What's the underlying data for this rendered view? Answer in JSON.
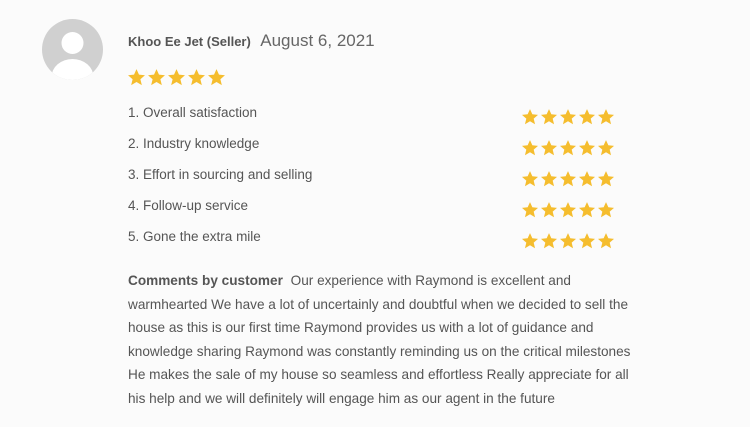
{
  "review": {
    "reviewer": "Khoo Ee Jet (Seller)",
    "date": "August 6, 2021",
    "overall_rating": 5,
    "max_rating": 5,
    "star_color": "#f5bd2e"
  },
  "criteria": [
    {
      "label": "1. Overall satisfaction",
      "rating": 5
    },
    {
      "label": "2. Industry knowledge",
      "rating": 5
    },
    {
      "label": "3. Effort in sourcing and selling",
      "rating": 5
    },
    {
      "label": "4. Follow-up service",
      "rating": 5
    },
    {
      "label": "5. Gone the extra mile",
      "rating": 5
    }
  ],
  "comment": {
    "label": "Comments by customer",
    "text": "Our experience with Raymond is excellent and warmhearted We have a lot of uncertainly and doubtful when we decided to sell the house as this is our first time Raymond provides us with a lot of guidance and knowledge sharing Raymond was constantly reminding us on the critical milestones He makes the sale of my house so seamless and effortless Really appreciate for all his help and we will definitely will engage him as our agent in the future"
  }
}
